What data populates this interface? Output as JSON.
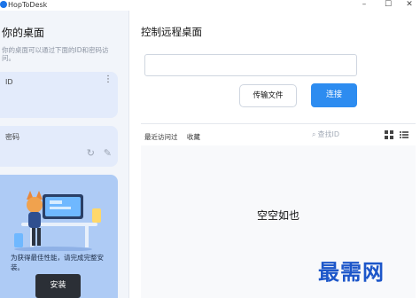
{
  "app": {
    "title": "HopToDesk"
  },
  "window_controls": {
    "minimize": "–",
    "maximize": "☐",
    "close": "✕"
  },
  "sidebar": {
    "title": "你的桌面",
    "description": "你的桌面可以通过下面的ID和密码访问。",
    "id_card": {
      "label": "ID"
    },
    "password_card": {
      "label": "密码"
    },
    "promo": {
      "text": "为获得最佳性能，请完成完整安装。",
      "install_label": "安装"
    }
  },
  "main": {
    "title": "控制远程桌面",
    "remote_id_value": "",
    "transfer_button": "传输文件",
    "connect_button": "连接",
    "tabs": [
      "最近访问过",
      "收藏"
    ],
    "search_placeholder": "查找ID",
    "empty_text": "空空如也"
  },
  "icons": {
    "menu": "kebab-menu-icon",
    "refresh": "refresh-icon",
    "edit": "pencil-icon",
    "search": "search-icon",
    "grid": "grid-view-icon",
    "list": "list-view-icon"
  },
  "colors": {
    "accent": "#2d8cf0",
    "card_bg": "#e3ebfb",
    "promo_bg": "#aecbf5",
    "watermark": "#1c56c9"
  },
  "watermark": {
    "text": "最需网"
  }
}
